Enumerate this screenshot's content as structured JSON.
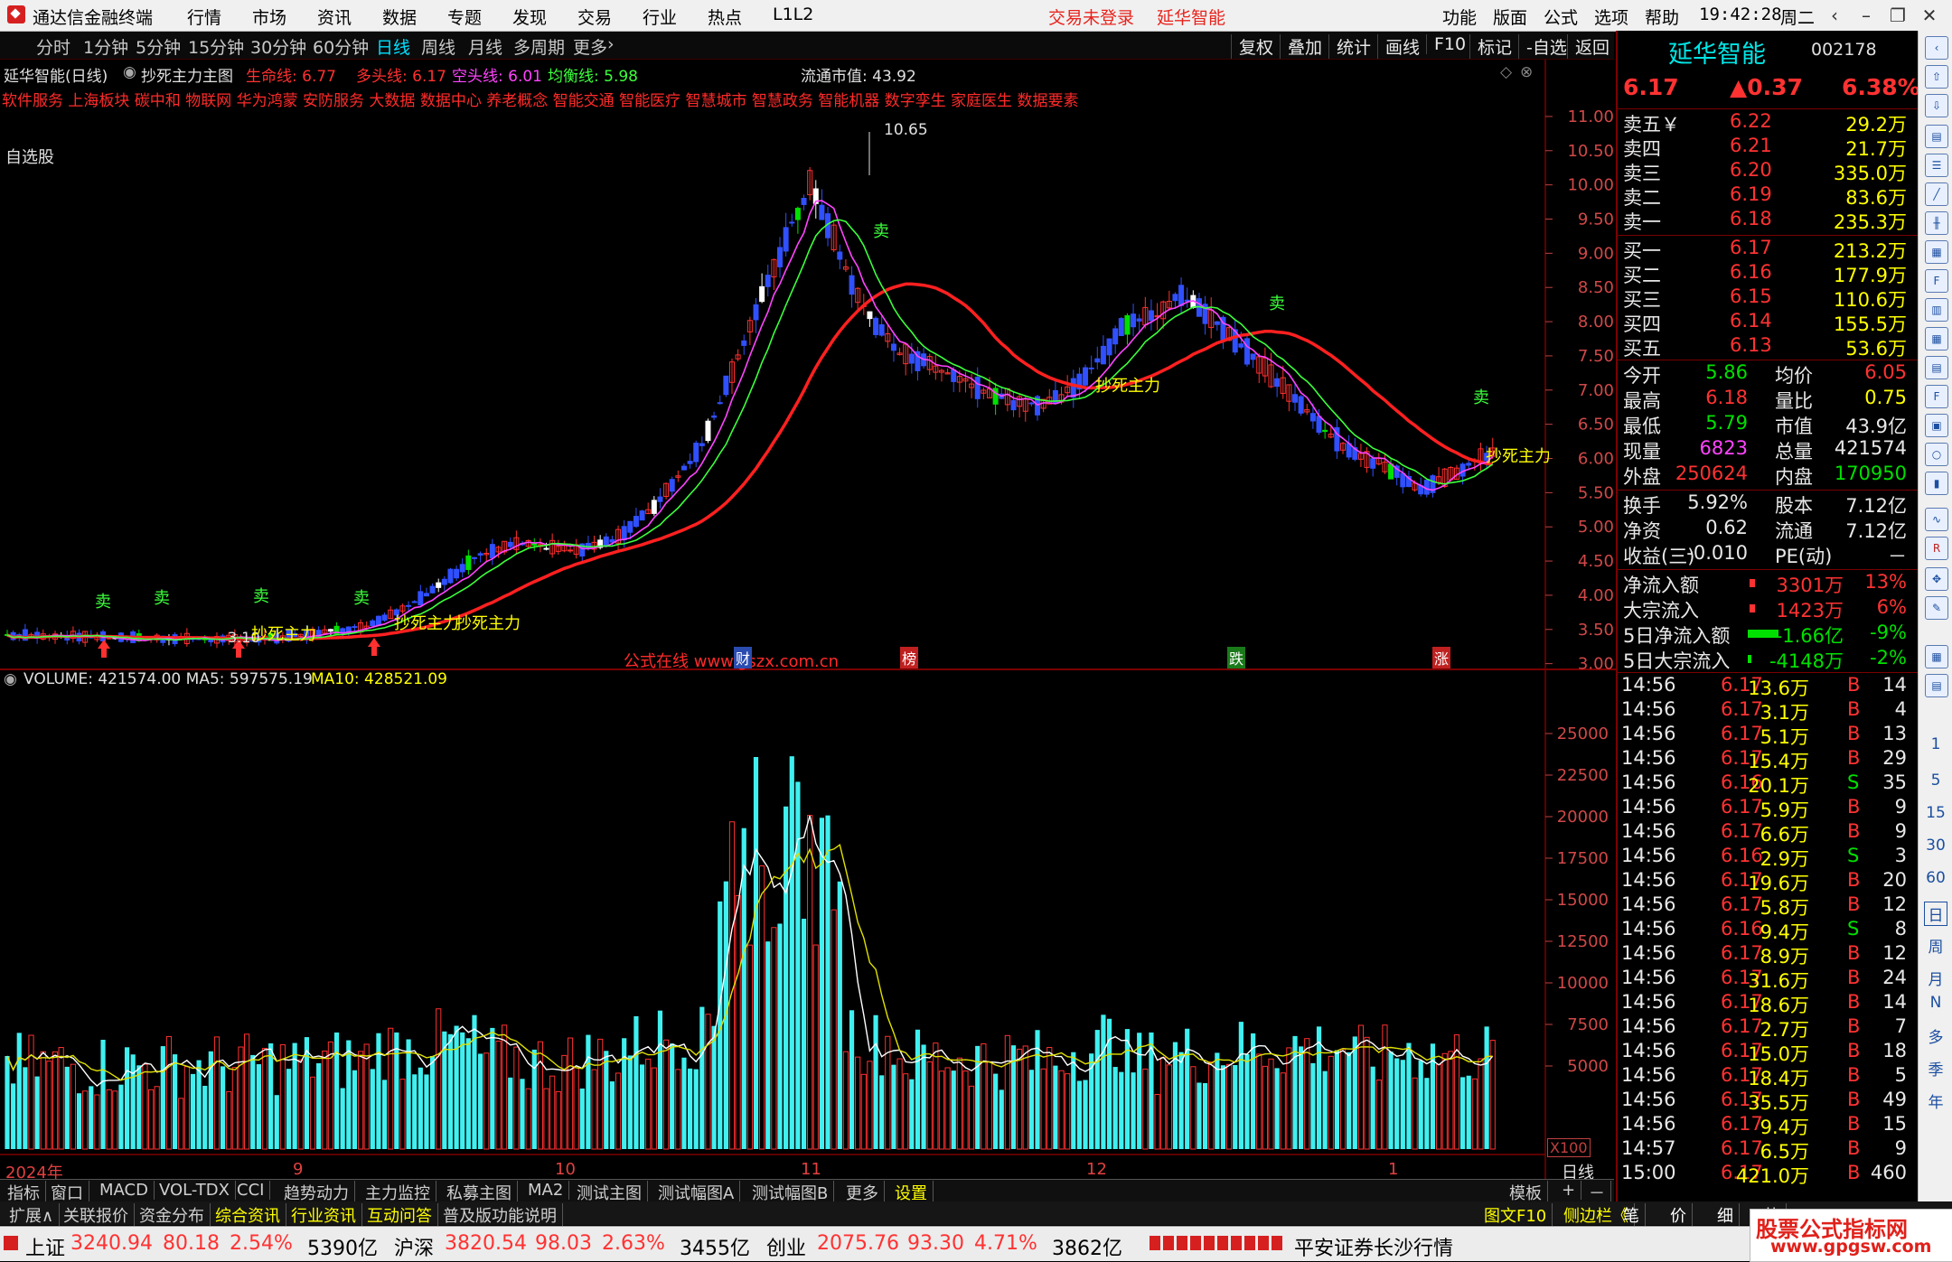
{
  "app": {
    "title": "通达信金融终端",
    "menu": [
      "行情",
      "市场",
      "资讯",
      "数据",
      "专题",
      "发现",
      "交易",
      "行业",
      "热点",
      "L1L2"
    ],
    "trade_status": "交易未登录",
    "stock_title": "延华智能",
    "right_menu": [
      "功能",
      "版面",
      "公式",
      "选项",
      "帮助"
    ],
    "time": "19:42:28",
    "weekday": "周二"
  },
  "toolbar": {
    "periods": [
      "分时",
      "1分钟",
      "5分钟",
      "15分钟",
      "30分钟",
      "60分钟",
      "日线",
      "周线",
      "月线",
      "多周期",
      "更多"
    ],
    "active_period": "日线",
    "right_buttons": [
      "复权",
      "叠加",
      "统计",
      "画线",
      "F10",
      "标记",
      "-自选",
      "返回"
    ]
  },
  "chart": {
    "name": "延华智能(日线)",
    "formula": "抄死主力主图",
    "lines": [
      {
        "label": "生命线:",
        "value": "6.77",
        "color": "#ff3030"
      },
      {
        "label": "多头线:",
        "value": "6.17",
        "color": "#ff3030"
      },
      {
        "label": "空头线:",
        "value": "6.01",
        "color": "#ff44ff"
      },
      {
        "label": "均衡线:",
        "value": "5.98",
        "color": "#3cff3c"
      }
    ],
    "market_cap": "流通市值: 43.92",
    "concepts": "软件服务 上海板块 碳中和 物联网 华为鸿蒙 安防服务 大数据 数据中心 养老概念 智能交通 智能医疗 智慧城市 智慧政务 智能机器 数字孪生 家庭医生 数据要素",
    "group_label": "自选股",
    "peak_label": "10.65",
    "low_label": "3.10",
    "signal_text": "抄死主力",
    "price_axis": [
      "11.00",
      "10.50",
      "10.00",
      "9.50",
      "9.00",
      "8.50",
      "8.00",
      "7.50",
      "7.00",
      "6.50",
      "6.00",
      "5.50",
      "5.00",
      "4.50",
      "4.00",
      "3.50",
      "3.00"
    ],
    "event_markers": [
      "财",
      "榜",
      "跌",
      "涨"
    ],
    "watermark": "公式在线  www.gszx.com.cn"
  },
  "volume": {
    "header": "VOLUME: 421574.00  MA5: 597575.19",
    "ma10": "MA10: 428521.09",
    "axis": [
      "25000",
      "22500",
      "20000",
      "17500",
      "15000",
      "12500",
      "10000",
      "7500",
      "5000"
    ],
    "unit": "X100",
    "months": [
      "2024年",
      "9",
      "10",
      "11",
      "12",
      "1"
    ],
    "period": "日线"
  },
  "quote": {
    "name": "延华智能",
    "code": "002178",
    "price": "6.17",
    "change": "▲0.37",
    "pct": "6.38%",
    "asks": [
      {
        "label": "卖五￥",
        "price": "6.22",
        "vol": "29.2万"
      },
      {
        "label": "卖四",
        "price": "6.21",
        "vol": "21.7万"
      },
      {
        "label": "卖三",
        "price": "6.20",
        "vol": "335.0万"
      },
      {
        "label": "卖二",
        "price": "6.19",
        "vol": "83.6万"
      },
      {
        "label": "卖一",
        "price": "6.18",
        "vol": "235.3万"
      }
    ],
    "bids": [
      {
        "label": "买一",
        "price": "6.17",
        "vol": "213.2万"
      },
      {
        "label": "买二",
        "price": "6.16",
        "vol": "177.9万"
      },
      {
        "label": "买三",
        "price": "6.15",
        "vol": "110.6万"
      },
      {
        "label": "买四",
        "price": "6.14",
        "vol": "155.5万"
      },
      {
        "label": "买五",
        "price": "6.13",
        "vol": "53.6万"
      }
    ],
    "stats": [
      {
        "l1": "今开",
        "v1": "5.86",
        "c1": "green",
        "l2": "均价",
        "v2": "6.05",
        "c2": "red"
      },
      {
        "l1": "最高",
        "v1": "6.18",
        "c1": "red",
        "l2": "量比",
        "v2": "0.75",
        "c2": "yellow"
      },
      {
        "l1": "最低",
        "v1": "5.79",
        "c1": "green",
        "l2": "市值",
        "v2": "43.9亿",
        "c2": "white"
      },
      {
        "l1": "现量",
        "v1": "6823",
        "c1": "magenta",
        "l2": "总量",
        "v2": "421574",
        "c2": "white"
      },
      {
        "l1": "外盘",
        "v1": "250624",
        "c1": "red",
        "l2": "内盘",
        "v2": "170950",
        "c2": "green"
      }
    ],
    "stats2": [
      {
        "l1": "换手",
        "v1": "5.92%",
        "l2": "股本",
        "v2": "7.12亿"
      },
      {
        "l1": "净资",
        "v1": "0.62",
        "l2": "流通",
        "v2": "7.12亿"
      },
      {
        "l1": "收益(三)",
        "v1": "-0.010",
        "l2": "PE(动)",
        "v2": "－"
      }
    ],
    "flows": [
      {
        "label": "净流入额",
        "value": "3301万",
        "pct": "13%",
        "color": "red"
      },
      {
        "label": "大宗流入",
        "value": "1423万",
        "pct": "6%",
        "color": "red"
      },
      {
        "label": "5日净流入额",
        "value": "-1.66亿",
        "pct": "-9%",
        "color": "green"
      },
      {
        "label": "5日大宗流入",
        "value": "-4148万",
        "pct": "-2%",
        "color": "green"
      }
    ]
  },
  "ticks": [
    [
      "14:56",
      "6.17",
      "13.6万",
      "B",
      "14"
    ],
    [
      "14:56",
      "6.17",
      "3.1万",
      "B",
      "4"
    ],
    [
      "14:56",
      "6.17",
      "5.1万",
      "B",
      "13"
    ],
    [
      "14:56",
      "6.17",
      "15.4万",
      "B",
      "29"
    ],
    [
      "14:56",
      "6.16",
      "20.1万",
      "S",
      "35"
    ],
    [
      "14:56",
      "6.17",
      "5.9万",
      "B",
      "9"
    ],
    [
      "14:56",
      "6.17",
      "6.6万",
      "B",
      "9"
    ],
    [
      "14:56",
      "6.16",
      "2.9万",
      "S",
      "3"
    ],
    [
      "14:56",
      "6.17",
      "19.6万",
      "B",
      "20"
    ],
    [
      "14:56",
      "6.17",
      "5.8万",
      "B",
      "12"
    ],
    [
      "14:56",
      "6.16",
      "9.4万",
      "S",
      "8"
    ],
    [
      "14:56",
      "6.17",
      "8.9万",
      "B",
      "12"
    ],
    [
      "14:56",
      "6.17",
      "31.6万",
      "B",
      "24"
    ],
    [
      "14:56",
      "6.17",
      "18.6万",
      "B",
      "14"
    ],
    [
      "14:56",
      "6.17",
      "2.7万",
      "B",
      "7"
    ],
    [
      "14:56",
      "6.17",
      "15.0万",
      "B",
      "18"
    ],
    [
      "14:56",
      "6.17",
      "18.4万",
      "B",
      "5"
    ],
    [
      "14:56",
      "6.17",
      "35.5万",
      "B",
      "49"
    ],
    [
      "14:56",
      "6.17",
      "9.4万",
      "B",
      "15"
    ],
    [
      "14:57",
      "6.17",
      "6.5万",
      "B",
      "9"
    ],
    [
      "15:00",
      "6.17",
      "421.0万",
      "B",
      "460"
    ]
  ],
  "sidebar_periods": [
    "1",
    "5",
    "15",
    "30",
    "60",
    "日",
    "周",
    "月",
    "N",
    "多",
    "季",
    "年"
  ],
  "tabs": [
    "指标",
    "窗口",
    "MACD",
    "VOL-TDX",
    "CCI",
    "趋势动力",
    "主力监控",
    "私募主图",
    "MA2",
    "测试主图",
    "测试幅图A",
    "测试幅图B",
    "更多",
    "设置"
  ],
  "tabs_right": [
    "模板",
    "+",
    "－"
  ],
  "tabs2": [
    "扩展∧",
    "关联报价",
    "资金分布",
    "综合资讯",
    "行业资讯",
    "互动问答",
    "普及版功能说明"
  ],
  "tabs2_right": [
    "图文F10",
    "侧边栏《",
    "笔",
    "价",
    "细",
    "势"
  ],
  "status": {
    "sh_label": "上证",
    "sh": "3240.94",
    "sh_chg": "80.18",
    "sh_pct": "2.54%",
    "sh_amt": "5390亿",
    "sz_label": "沪深",
    "sz": "3820.54",
    "sz_chg": "98.03",
    "sz_pct": "2.63%",
    "sz_amt": "3455亿",
    "cy_label": "创业",
    "cy": "2075.76",
    "cy_chg": "93.30",
    "cy_pct": "4.71%",
    "cy_amt": "3862亿",
    "broker": "平安证券长沙行情"
  },
  "site_watermark": {
    "line1": "股票公式指标网",
    "line2": "www.gpgsw.com"
  },
  "chart_data": {
    "type": "candlestick",
    "volume_ylim": [
      0,
      27000
    ]
  }
}
